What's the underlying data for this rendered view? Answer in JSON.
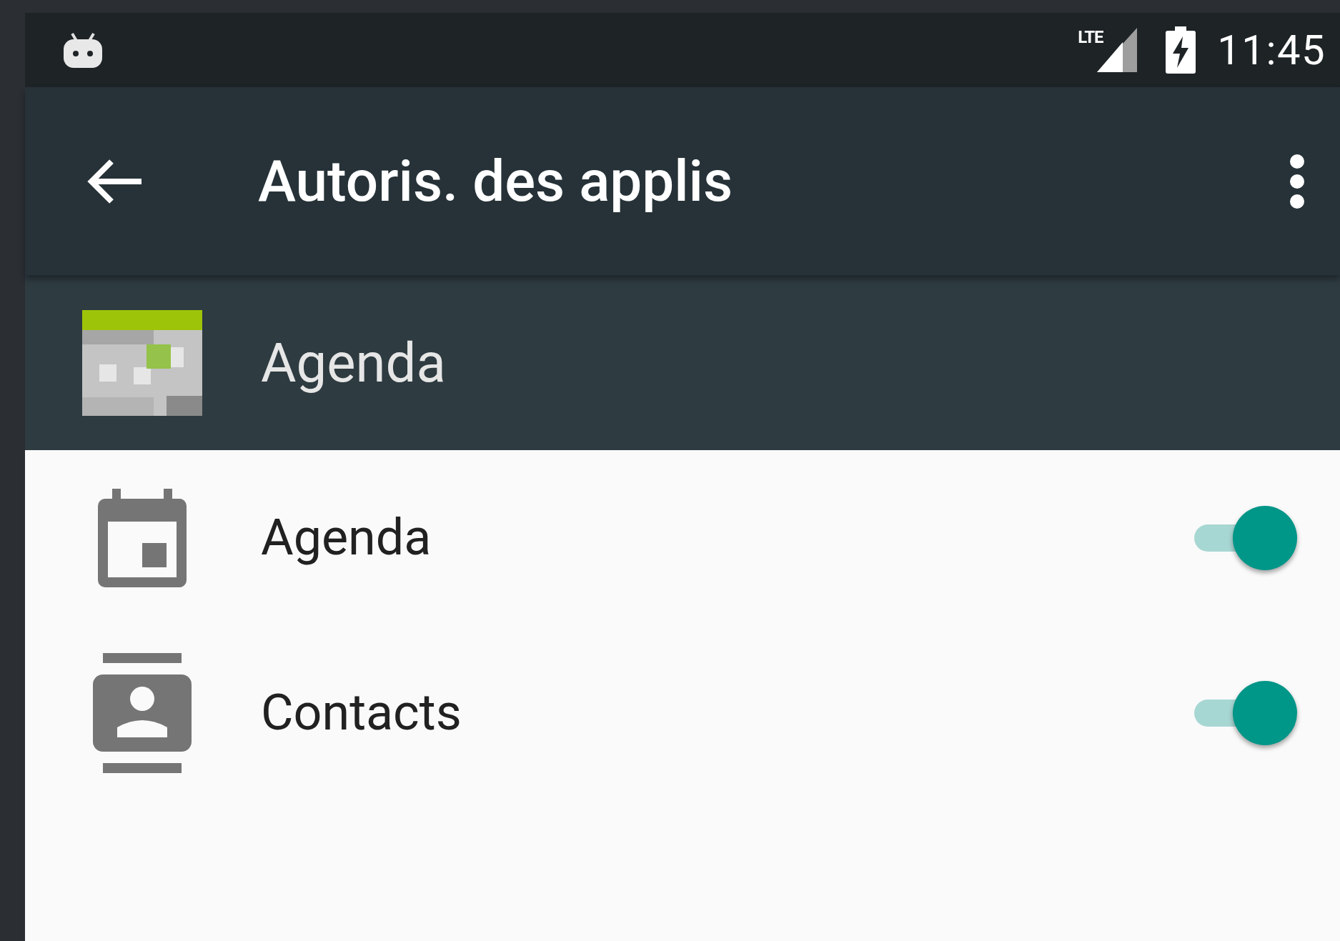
{
  "status_bar": {
    "network": "LTE",
    "time": "11:45"
  },
  "toolbar": {
    "title": "Autoris. des applis"
  },
  "app_header": {
    "name": "Agenda"
  },
  "permissions": [
    {
      "kind": "calendar",
      "label": "Agenda",
      "on": true
    },
    {
      "kind": "contacts",
      "label": "Contacts",
      "on": true
    }
  ]
}
